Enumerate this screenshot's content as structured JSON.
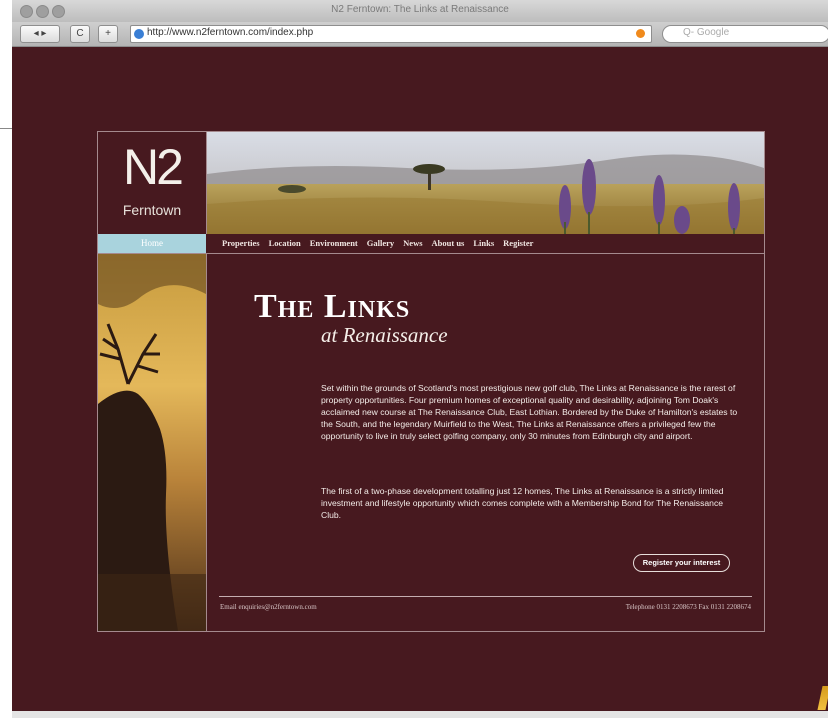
{
  "browser": {
    "window_title": "N2 Ferntown: The Links at Renaissance",
    "url": "http://www.n2ferntown.com/index.php",
    "search_placeholder": "Q- Google",
    "back_label": "◂ ▸",
    "reload_label": "C",
    "add_label": "+"
  },
  "site": {
    "logo_mark": "N2",
    "logo_text": "Ferntown",
    "nav": {
      "home": "Home",
      "items": [
        "Properties",
        "Location",
        "Environment",
        "Gallery",
        "News",
        "About us",
        "Links",
        "Register"
      ]
    },
    "heading": "The Links",
    "subheading": "at Renaissance",
    "paragraphs": [
      "Set within the grounds of Scotland's most prestigious new golf club, The Links at Renaissance is the rarest of property opportunities. Four premium homes of exceptional quality and desirability, adjoining Tom Doak's acclaimed new course at The Renaissance Club, East Lothian. Bordered by the Duke of Hamilton's estates to the South, and the legendary Muirfield to the West, The Links at Renaissance offers a privileged few the opportunity to live in truly select golfing company, only 30 minutes from Edinburgh city and airport.",
      "The first of a two-phase development totalling just 12 homes, The Links at Renaissance is a strictly limited investment and lifestyle opportunity which comes complete with a Membership Bond for The Renaissance Club."
    ],
    "register_button": "Register your interest",
    "footer_email": "Email enquiries@n2ferntown.com",
    "footer_phone": "Telephone 0131 2208673 Fax 0131 2208674"
  },
  "colors": {
    "background": "#47191f",
    "nav_home": "#a9d3dd",
    "border": "#a58a8e"
  }
}
